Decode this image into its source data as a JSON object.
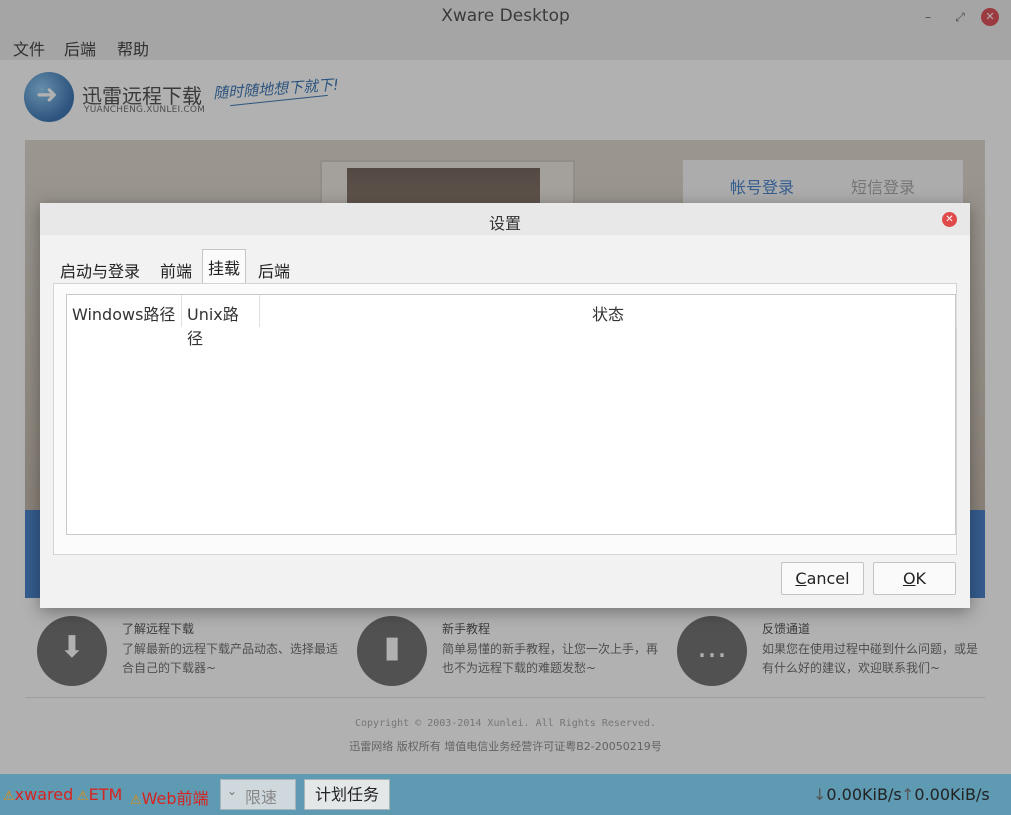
{
  "window": {
    "title": "Xware Desktop",
    "minimize_icon": "minimize-icon",
    "maximize_icon": "maximize-icon",
    "close_icon": "close-icon"
  },
  "menubar": {
    "items": [
      "文件",
      "后端",
      "帮助"
    ]
  },
  "web": {
    "logo": {
      "name": "迅雷远程下载",
      "url": "YUANCHENG.XUNLEI.COM",
      "slogan": "随时随地想下就下!"
    },
    "login_tabs": [
      "帐号登录",
      "短信登录"
    ],
    "features": [
      {
        "icon": "download-box-icon",
        "title": "了解远程下载",
        "desc": "了解最新的远程下载产品动态、选择最适合自己的下载器~"
      },
      {
        "icon": "document-icon",
        "title": "新手教程",
        "desc": "简单易懂的新手教程，让您一次上手，再也不为远程下载的难题发愁~"
      },
      {
        "icon": "chat-bubble-icon",
        "title": "反馈通道",
        "desc": "如果您在使用过程中碰到什么问题，或是有什么好的建议，欢迎联系我们~"
      }
    ],
    "copyright": "Copyright © 2003-2014 Xunlei. All Rights Reserved.",
    "license": "迅雷网络 版权所有 增值电信业务经营许可证粤B2-20050219号"
  },
  "statusbar": {
    "items": [
      "xwared",
      "ETM",
      "Web前端"
    ],
    "warn_icon": "warning-icon",
    "speed_limit_label": "限速",
    "schedule_label": "计划任务",
    "download_speed": "0.00KiB/s",
    "upload_speed": "0.00KiB/s"
  },
  "dialog": {
    "title": "设置",
    "tabs": [
      "启动与登录",
      "前端",
      "挂载",
      "后端"
    ],
    "active_tab": "挂载",
    "table": {
      "columns": [
        "Windows路径",
        "Unix路径",
        "状态"
      ],
      "rows": []
    },
    "cancel_mnemonic": "C",
    "cancel_rest": "ancel",
    "ok_mnemonic": "O",
    "ok_rest": "K"
  },
  "colors": {
    "statusbar_bg": "#5f9ab3",
    "error_text": "#d6241f",
    "warning": "#e98a00",
    "brand_blue": "#2a6fc5"
  }
}
